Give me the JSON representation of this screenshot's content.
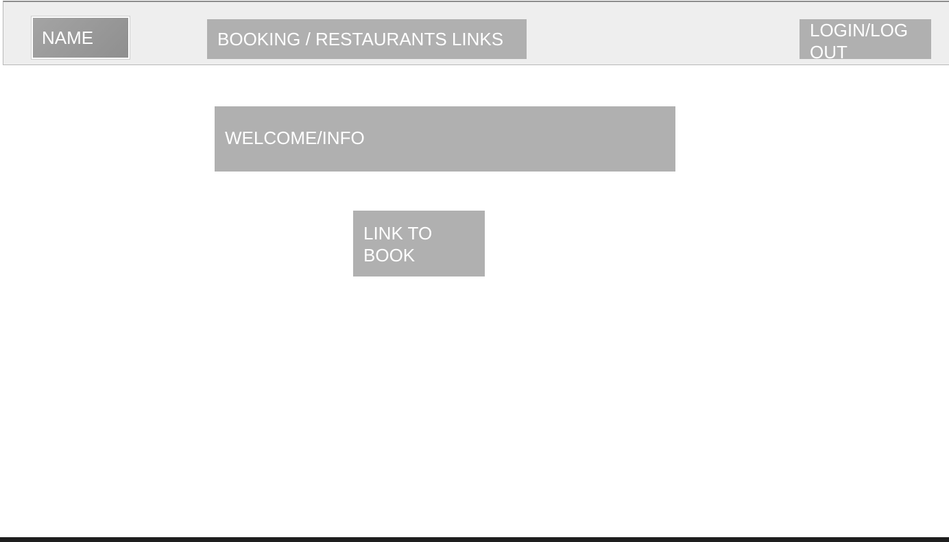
{
  "header": {
    "name_label": "NAME",
    "nav_label": "BOOKING / RESTAURANTS LINKS",
    "auth_label_line1": "LOGIN/LOG",
    "auth_label_line2": "OUT"
  },
  "main": {
    "welcome_label": "WELCOME/INFO",
    "book_link_line1": "LINK TO",
    "book_link_line2": "BOOK"
  }
}
